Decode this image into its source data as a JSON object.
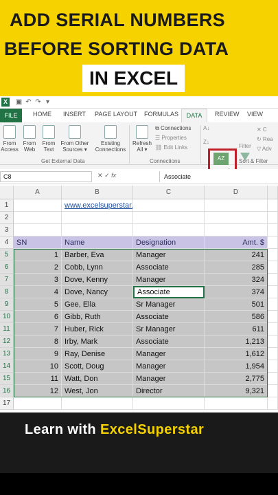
{
  "banner": {
    "line1": "ADD SERIAL NUMBERS",
    "line2": "BEFORE SORTING DATA",
    "line3": "IN EXCEL"
  },
  "ribbon": {
    "tabs": [
      "FILE",
      "HOME",
      "INSERT",
      "PAGE LAYOUT",
      "FORMULAS",
      "DATA",
      "REVIEW",
      "VIEW"
    ],
    "active_tab": "DATA",
    "buttons": {
      "from_access": "From Access",
      "from_web": "From Web",
      "from_text": "From Text",
      "from_other": "From Other Sources ▾",
      "existing": "Existing Connections",
      "refresh": "Refresh All ▾",
      "connections": "Connections",
      "properties": "Properties",
      "edit_links": "Edit Links",
      "filter": "Filter"
    },
    "groups": {
      "external": "Get External Data",
      "connections": "Connections",
      "sort_filter": "Sort & Filter"
    }
  },
  "formula_bar": {
    "name_box": "C8",
    "fx": "fx",
    "value": "Associate"
  },
  "grid": {
    "columns": [
      "A",
      "B",
      "C",
      "D"
    ],
    "link": "www.excelsuperstar.org",
    "headers": {
      "sn": "SN",
      "name": "Name",
      "designation": "Designation",
      "amt": "Amt. $"
    },
    "rows": [
      {
        "sn": "1",
        "name": "Barber, Eva",
        "designation": "Manager",
        "amt": "241"
      },
      {
        "sn": "2",
        "name": "Cobb, Lynn",
        "designation": "Associate",
        "amt": "285"
      },
      {
        "sn": "3",
        "name": "Dove, Kenny",
        "designation": "Manager",
        "amt": "324"
      },
      {
        "sn": "4",
        "name": "Dove, Nancy",
        "designation": "Associate",
        "amt": "374"
      },
      {
        "sn": "5",
        "name": "Gee, Ella",
        "designation": "Sr Manager",
        "amt": "501"
      },
      {
        "sn": "6",
        "name": "Gibb, Ruth",
        "designation": "Associate",
        "amt": "586"
      },
      {
        "sn": "7",
        "name": "Huber, Rick",
        "designation": "Sr Manager",
        "amt": "611"
      },
      {
        "sn": "8",
        "name": "Irby, Mark",
        "designation": "Associate",
        "amt": "1,213"
      },
      {
        "sn": "9",
        "name": "Ray, Denise",
        "designation": "Manager",
        "amt": "1,612"
      },
      {
        "sn": "10",
        "name": "Scott, Doug",
        "designation": "Manager",
        "amt": "1,954"
      },
      {
        "sn": "11",
        "name": "Watt, Don",
        "designation": "Manager",
        "amt": "2,775"
      },
      {
        "sn": "12",
        "name": "West, Jon",
        "designation": "Director",
        "amt": "9,321"
      }
    ]
  },
  "footer": {
    "prefix": "Learn with ",
    "brand": "ExcelSuperstar"
  },
  "colors": {
    "banner": "#f5d200",
    "excel_green": "#217346",
    "header_fill": "#c9c4e6",
    "highlight_red": "#c0202a"
  }
}
